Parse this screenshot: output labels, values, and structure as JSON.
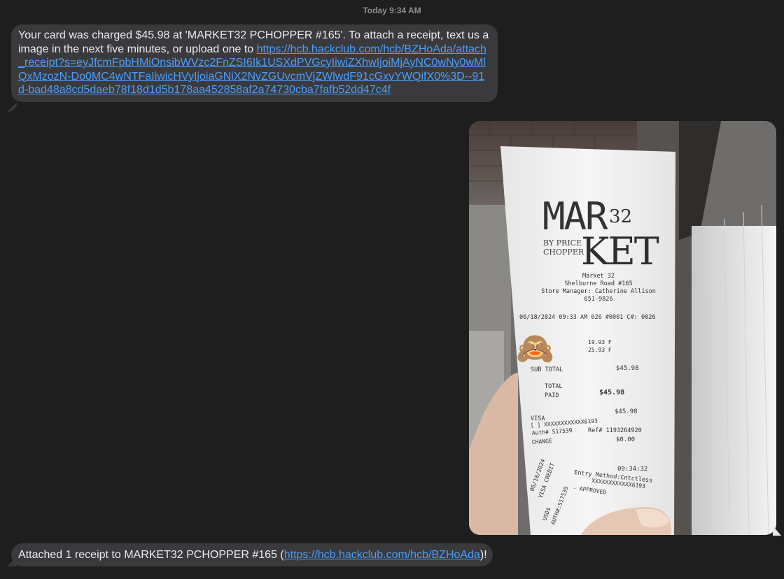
{
  "conversation": {
    "timestamp": "Today 9:34 AM",
    "message1": {
      "text_before": "Your card was charged $45.98 at 'MARKET32 PCHOPPER #165'. To attach a receipt, text us a image in the next five minutes, or upload one to ",
      "link": "https://hcb.hackclub.com/hcb/BZHoAda/attach_receipt?s=eyJfcmFpbHMiOnsibWVzc2FnZSI6Ik1USXdPVGcyIiwiZXhwIjoiMjAyNC0wNy0wMlQxMzozN-Do0MC4wNTFaIiwicHVyIjoiaGNiX2NvZGUvcmVjZWlwdF91cGxvYWQifX0%3D--91d-bad48a8cd5daeb78f18d1d5b178aa452858af2a74730cba7fafb52dd47c4f"
    },
    "photo": {
      "description_icon": "receipt-photo",
      "receipt": {
        "logo_word1": "MAR",
        "logo_number": "32",
        "logo_word2": "KET",
        "logo_by": "BY PRICE",
        "logo_chopper": "CHOPPER",
        "store_line1": "Market 32",
        "store_line2": "Shelburne Road #165",
        "store_line3": "Store Manager: Catherine Allison",
        "store_line4": "651-9826",
        "date_line": "06/18/2024 09:33 AM  026  #0001  C#: 0026",
        "emoji": "🙈",
        "item1_price": "19.93  F",
        "item2_price": "25.93  F",
        "subtotal_label": "SUB TOTAL",
        "subtotal_value": "$45.98",
        "total_label": "TOTAL",
        "paid_label": "PAID",
        "total_value": "$45.98",
        "visa_label": "VISA",
        "visa_value": "$45.98",
        "card_line": "[ ] XXXXXXXXXXXX6193",
        "auth_line": "Auth# S17539",
        "ref_line": "Ref# 1193264920",
        "change_label": "CHANGE",
        "change_value": "$0.00",
        "time2": "09:34:32",
        "entry_method": "Entry Method:Cntctless",
        "card_line2": "XXXXXXXXXXXX6193",
        "approved": "- APPROVED",
        "side1": "06/18/2024",
        "side2": "VISA CREDIT",
        "side3": "USD$",
        "side4": "AUTH#:S17539"
      }
    },
    "message3": {
      "text_before": "Attached 1 receipt to MARKET32 PCHOPPER #165 (",
      "link": "https://hcb.hackclub.com/hcb/BZHoAda",
      "text_after": ")!"
    }
  }
}
